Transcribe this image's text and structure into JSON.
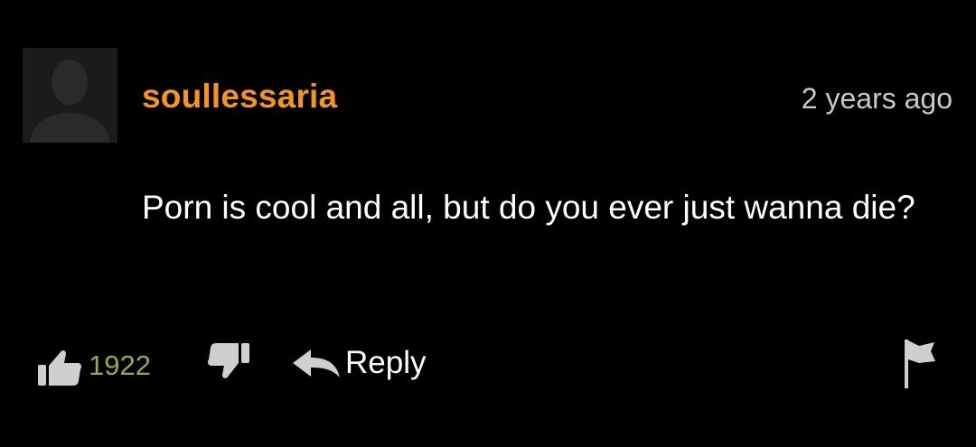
{
  "comment": {
    "username": "soullessaria",
    "timestamp": "2 years ago",
    "text": "Porn is cool and all, but do you ever just wanna die?",
    "likes": "1922",
    "reply_label": "Reply"
  },
  "icons": {
    "avatar": "default-user-silhouette",
    "like": "thumb-up-icon",
    "dislike": "thumb-down-icon",
    "reply": "reply-arrow-icon",
    "report": "flag-icon"
  },
  "colors": {
    "background": "#000000",
    "username": "#f5961a",
    "likes": "#8fae4a",
    "text": "#ffffff",
    "muted": "#c8c8c8"
  }
}
